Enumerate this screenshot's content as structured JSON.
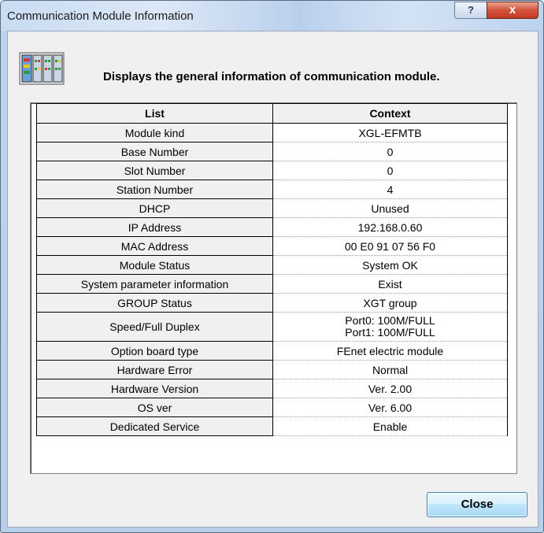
{
  "window": {
    "title": "Communication Module Information",
    "help_label": "?",
    "close_label": "x"
  },
  "heading": "Displays the general information of communication module.",
  "table": {
    "columns": [
      "List",
      "Context"
    ],
    "rows": [
      {
        "list": "Module kind",
        "context": "XGL-EFMTB"
      },
      {
        "list": "Base Number",
        "context": "0"
      },
      {
        "list": "Slot Number",
        "context": "0"
      },
      {
        "list": "Station Number",
        "context": "4"
      },
      {
        "list": "DHCP",
        "context": "Unused"
      },
      {
        "list": "IP Address",
        "context": "192.168.0.60"
      },
      {
        "list": "MAC Address",
        "context": "00 E0 91 07 56 F0"
      },
      {
        "list": "Module Status",
        "context": "System OK"
      },
      {
        "list": "System parameter information",
        "context": "Exist"
      },
      {
        "list": "GROUP Status",
        "context": "XGT group"
      },
      {
        "list": "Speed/Full Duplex",
        "context": "Port0: 100M/FULL",
        "context2": "Port1: 100M/FULL"
      },
      {
        "list": "Option board type",
        "context": "FEnet electric module"
      },
      {
        "list": "Hardware Error",
        "context": "Normal"
      },
      {
        "list": "Hardware Version",
        "context": "Ver. 2.00"
      },
      {
        "list": "OS ver",
        "context": "Ver. 6.00"
      },
      {
        "list": "Dedicated Service",
        "context": "Enable"
      }
    ]
  },
  "buttons": {
    "close": "Close"
  },
  "icons": {
    "module": "plc-module-icon"
  },
  "colors": {
    "titlebar": "#c9dcf2",
    "close_button": "#c23a20",
    "dialog_bg": "#f0f0f0"
  }
}
